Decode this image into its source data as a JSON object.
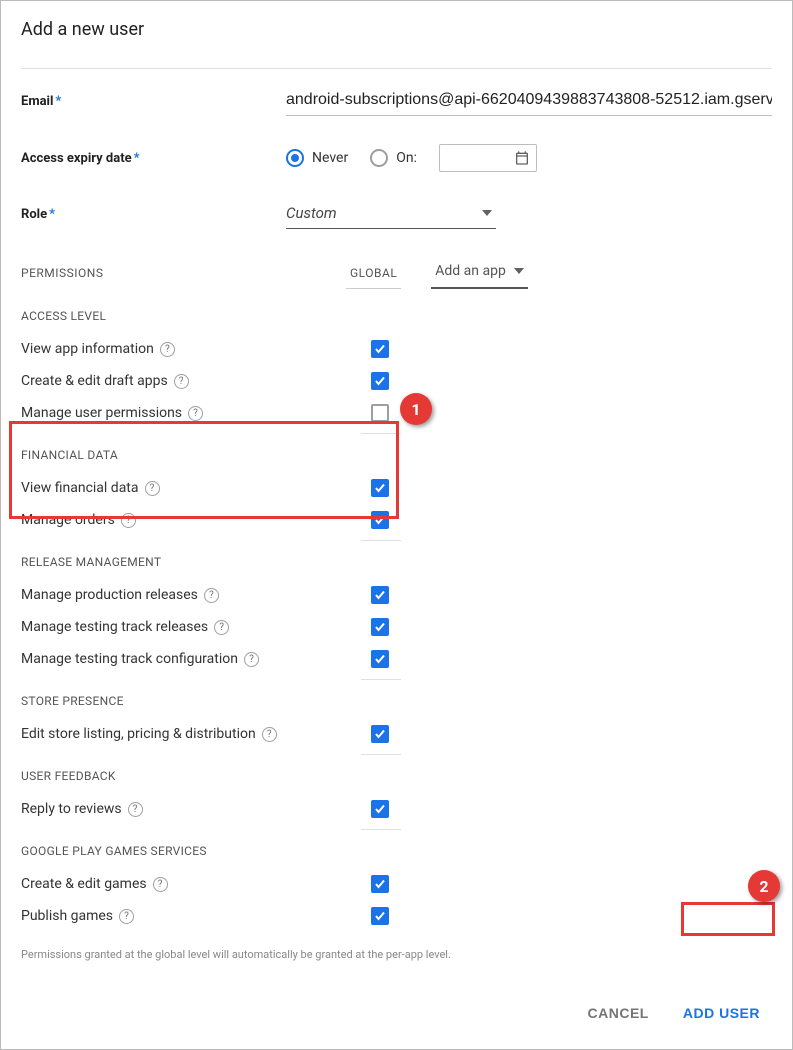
{
  "title": "Add a new user",
  "fields": {
    "email_label": "Email",
    "email_value": "android-subscriptions@api-6620409439883743808-52512.iam.gserv",
    "expiry_label": "Access expiry date",
    "expiry_never": "Never",
    "expiry_on": "On:",
    "role_label": "Role",
    "role_value": "Custom"
  },
  "tabs": {
    "permissions": "PERMISSIONS",
    "global": "GLOBAL",
    "add_app": "Add an app"
  },
  "sections": {
    "access_level": "ACCESS LEVEL",
    "financial_data": "FINANCIAL DATA",
    "release_mgmt": "RELEASE MANAGEMENT",
    "store_presence": "STORE PRESENCE",
    "user_feedback": "USER FEEDBACK",
    "games_services": "GOOGLE PLAY GAMES SERVICES"
  },
  "perms": {
    "view_app_info": "View app information",
    "create_edit_drafts": "Create & edit draft apps",
    "manage_user_perms": "Manage user permissions",
    "view_financial": "View financial data",
    "manage_orders": "Manage orders",
    "manage_prod_rel": "Manage production releases",
    "manage_test_rel": "Manage testing track releases",
    "manage_test_cfg": "Manage testing track configuration",
    "edit_store_listing": "Edit store listing, pricing & distribution",
    "reply_reviews": "Reply to reviews",
    "create_edit_games": "Create & edit games",
    "publish_games": "Publish games"
  },
  "footnote": "Permissions granted at the global level will automatically be granted at the per-app level.",
  "buttons": {
    "cancel": "CANCEL",
    "add_user": "ADD USER"
  },
  "callouts": {
    "one": "1",
    "two": "2"
  }
}
